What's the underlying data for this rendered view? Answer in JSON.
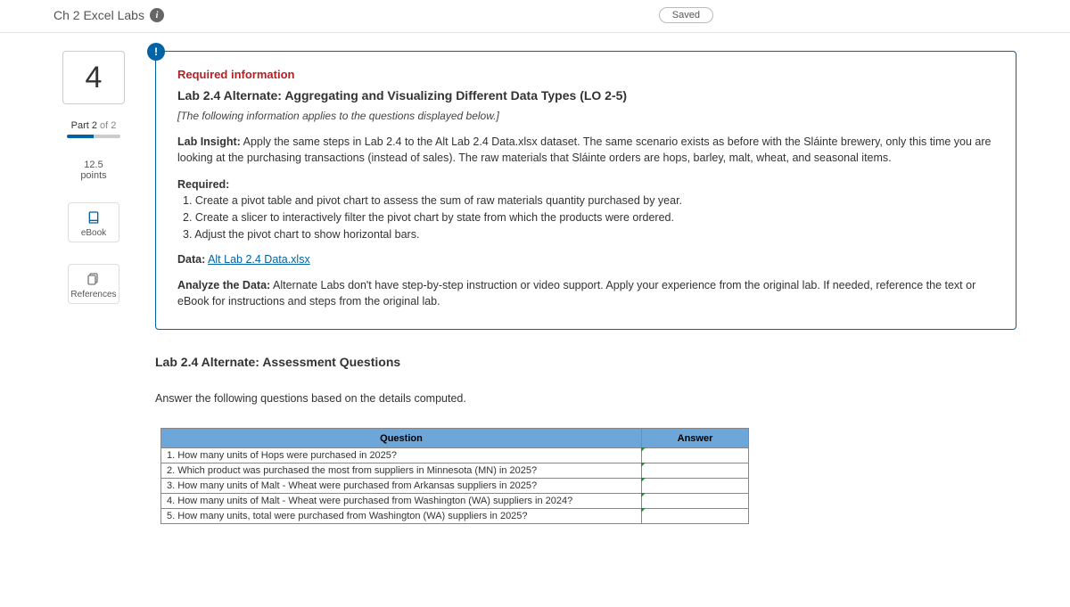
{
  "header": {
    "title": "Ch 2 Excel Labs",
    "saved_label": "Saved"
  },
  "sidebar": {
    "question_number": "4",
    "part_label_prefix": "Part ",
    "part_current": "2",
    "part_of": " of ",
    "part_total": "2",
    "points_value": "12.5",
    "points_label": "points",
    "ebook_label": "eBook",
    "references_label": "References"
  },
  "card": {
    "bang": "!",
    "required_info": "Required information",
    "subtitle": "Lab 2.4 Alternate: Aggregating and Visualizing Different Data Types (LO 2-5)",
    "applies_note": "[The following information applies to the questions displayed below.]",
    "insight_lead": "Lab Insight:",
    "insight_text": " Apply the same steps in Lab 2.4 to the Alt Lab 2.4 Data.xlsx dataset. The same scenario exists as before with the Sláinte brewery, only this time you are looking at the purchasing transactions (instead of sales). The raw materials that Sláinte orders are hops, barley, malt, wheat, and seasonal items.",
    "required_heading": "Required:",
    "required_items": [
      "1. Create a pivot table and pivot chart to assess the sum of raw materials quantity purchased by year.",
      "2. Create a slicer to interactively filter the pivot chart by state from which the products were ordered.",
      "3. Adjust the pivot chart to show horizontal bars."
    ],
    "data_lead": "Data:",
    "data_link": "Alt Lab 2.4 Data.xlsx",
    "analyze_lead": "Analyze the Data:",
    "analyze_text": " Alternate Labs don't have step-by-step instruction or video support. Apply your experience from the original lab. If needed, reference the text or eBook for instructions and steps from the original lab."
  },
  "assessment": {
    "title": "Lab 2.4 Alternate: Assessment Questions",
    "instruction": "Answer the following questions based on the details computed.",
    "table": {
      "question_header": "Question",
      "answer_header": "Answer",
      "rows": [
        "1. How many units of Hops were purchased in 2025?",
        "2. Which product was purchased the most from suppliers in Minnesota (MN) in 2025?",
        "3. How many units of Malt - Wheat were purchased from Arkansas suppliers in 2025?",
        "4. How many units of Malt - Wheat were purchased from Washington (WA) suppliers in 2024?",
        "5. How many units, total were purchased from Washington (WA) suppliers in 2025?"
      ]
    }
  }
}
